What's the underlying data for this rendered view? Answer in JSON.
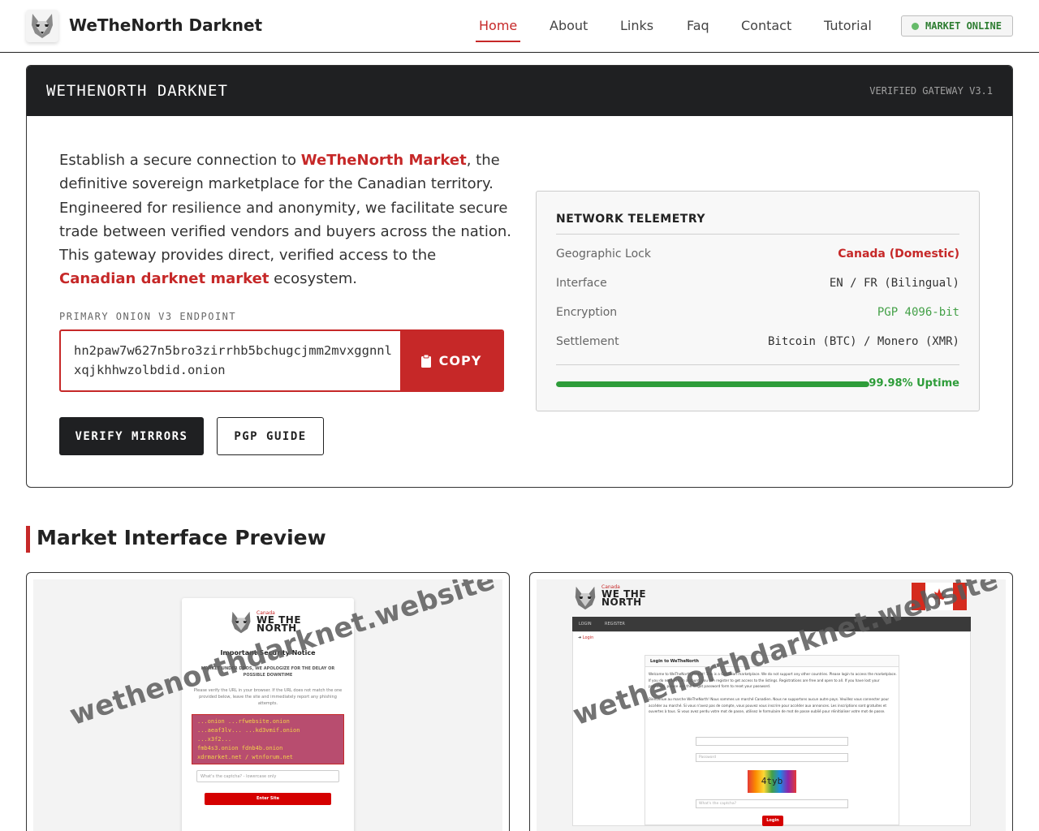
{
  "header": {
    "brand": "WeTheNorth Darknet",
    "nav": [
      {
        "label": "Home",
        "active": true
      },
      {
        "label": "About"
      },
      {
        "label": "Links"
      },
      {
        "label": "Faq"
      },
      {
        "label": "Contact"
      },
      {
        "label": "Tutorial"
      }
    ],
    "status": "MARKET ONLINE",
    "logo_icon": "wolf-icon"
  },
  "gateway": {
    "title": "WETHENORTH DARKNET",
    "version": "VERIFIED GATEWAY V3.1",
    "intro": {
      "p1": "Establish a secure connection to ",
      "hl1": "WeTheNorth Market",
      "p2": ", the definitive sovereign marketplace for the Canadian territory. Engineered for resilience and anonymity, we facilitate secure trade between verified vendors and buyers across the nation. This gateway provides direct, verified access to the ",
      "hl2": "Canadian darknet market",
      "p3": " ecosystem."
    },
    "endpoint_label": "PRIMARY ONION V3 ENDPOINT",
    "endpoint": "hn2paw7w627n5bro3zirrhb5bchugcjmm2mvxggnnlxqjkhhwzolbdid.onion",
    "copy_label": "COPY",
    "verify_label": "VERIFY MIRRORS",
    "pgp_label": "PGP GUIDE"
  },
  "telemetry": {
    "title": "NETWORK TELEMETRY",
    "rows": [
      {
        "key": "Geographic Lock",
        "value": "Canada (Domestic)"
      },
      {
        "key": "Interface",
        "value": "EN / FR (Bilingual)"
      },
      {
        "key": "Encryption",
        "value": "PGP 4096-bit"
      },
      {
        "key": "Settlement",
        "value": "Bitcoin (BTC) / Monero (XMR)"
      }
    ],
    "uptime_label": "99.98% Uptime",
    "uptime_percent": 99.98
  },
  "preview": {
    "title": "Market Interface Preview",
    "watermark": "wethenorthdarknet.website",
    "left": {
      "canada": "Canada",
      "logo_line1": "WE THE",
      "logo_line2": "NORTH",
      "notice": "Important Security Notice",
      "ddos": "MARKET UNDER DDOS, WE APOLOGIZE FOR THE DELAY OR POSSIBLE DOWNTIME",
      "para": "Please verify the URL in your browser. If the URL does not match the one provided below, leave the site and immediately report any phishing attempts.",
      "captcha_lines": [
        "...onion  ...rfwebsite.onion",
        "...aeaf3lv... ...kd3vmif.onion",
        "...x3f2...",
        "fmb4s3.onion  fdnb4b.onion",
        "xdrmarket.net / wtnforum.net"
      ],
      "captcha_placeholder": "What's the captcha? - lowercase only",
      "enter_label": "Enter Site"
    },
    "right": {
      "canada": "Canada",
      "logo_line1": "WE THE",
      "logo_line2": "NORTH",
      "nav_login": "LOGIN",
      "nav_register": "REGISTER",
      "crumb": "Login",
      "panel_title": "Login to WeTheNorth",
      "text_en": "Welcome to WeTheNorth Market! This is a Canadian marketplace. We do not support any other countries. Please login to access the marketplace. If you do not have an account, you can register to get access to the listings. Registrations are free and open to all. If you have lost your password, please use the forgot password form to reset your password.",
      "text_fr": "Bienvenue au marche WeTheNorth! Nous sommes un marché Canadien. Nous ne supportons aucun autre pays. Veuillez vous connecter pour accéder au marché. Si vous n'avez pas de compte, vous pouvez vous inscrire pour accéder aux annonces. Les inscriptions sont gratuites et ouvertes à tous. Si vous avez perdu votre mot de passe, utilisez le formulaire de mot de passe oublié pour réinitialiser votre mot de passe.",
      "username_placeholder": "",
      "password_placeholder": "Password",
      "captcha_text": "4tyb",
      "captcha_placeholder": "What's the captcha?",
      "login_label": "Login"
    }
  },
  "colors": {
    "accent": "#c62828",
    "dark": "#1f2022",
    "online": "#2e7d32",
    "uptime": "#2e9d3a"
  }
}
